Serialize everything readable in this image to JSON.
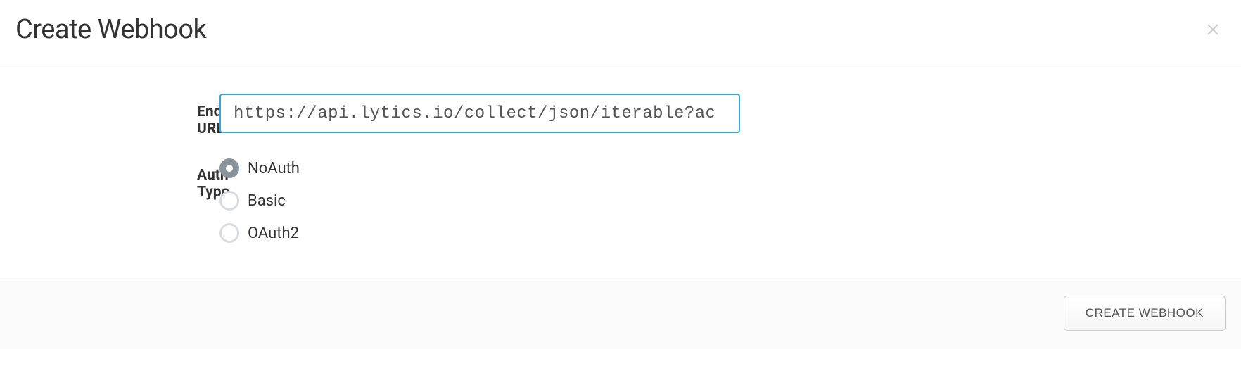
{
  "modal": {
    "title": "Create Webhook",
    "close_label": "Close"
  },
  "form": {
    "endpoint": {
      "label": "Endpoint URL",
      "value": "https://api.lytics.io/collect/json/iterable?ac"
    },
    "auth_type": {
      "label": "Auth Type",
      "selected": "NoAuth",
      "options": [
        {
          "value": "NoAuth",
          "label": "NoAuth"
        },
        {
          "value": "Basic",
          "label": "Basic"
        },
        {
          "value": "OAuth2",
          "label": "OAuth2"
        }
      ]
    }
  },
  "footer": {
    "create_button": "CREATE WEBHOOK"
  }
}
